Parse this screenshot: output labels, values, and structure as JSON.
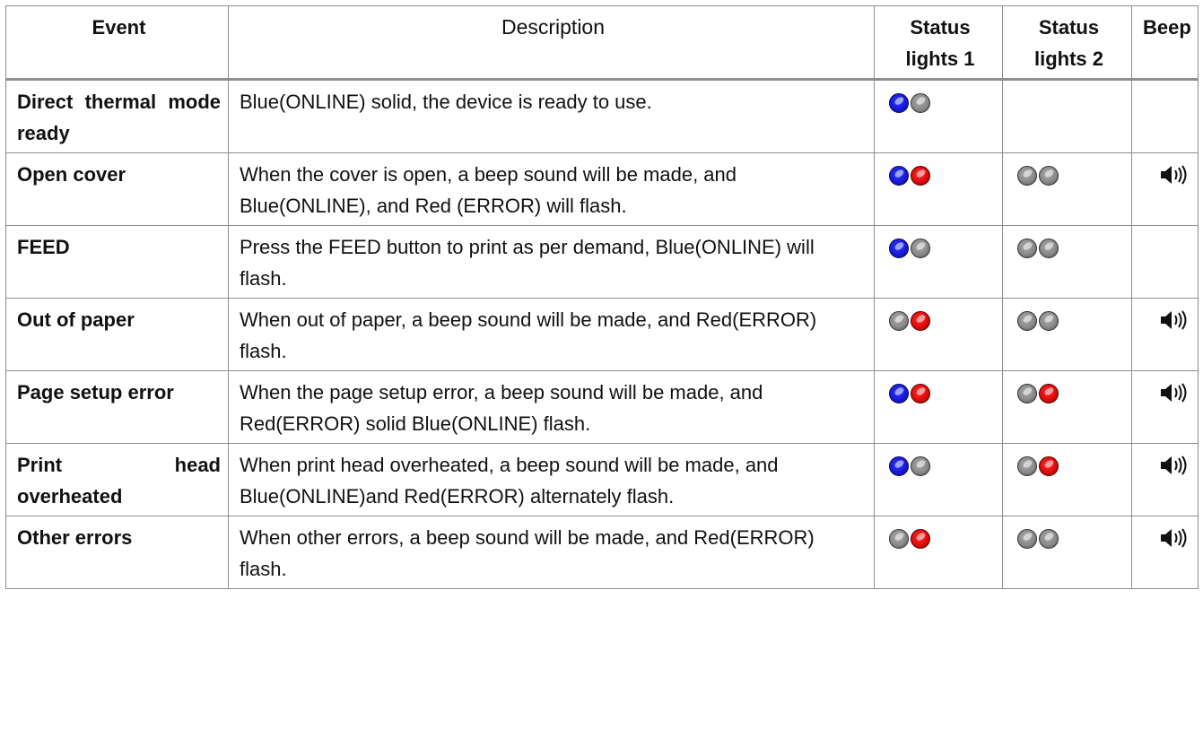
{
  "table": {
    "headers": {
      "event": "Event",
      "description": "Description",
      "status1": "Status lights 1",
      "status2": "Status lights 2",
      "beep": "Beep"
    },
    "rows": [
      {
        "event": "Direct thermal mode ready",
        "description": "Blue(ONLINE) solid, the device is ready to use.",
        "lights1": [
          "blue",
          "gray"
        ],
        "lights2": [],
        "beep": false
      },
      {
        "event": "Open cover",
        "description": "When the cover is open, a beep sound will be made, and Blue(ONLINE), and Red (ERROR) will flash.",
        "lights1": [
          "blue",
          "red"
        ],
        "lights2": [
          "gray",
          "gray"
        ],
        "beep": true
      },
      {
        "event": "FEED",
        "description": "Press the FEED button to print as per demand, Blue(ONLINE) will flash.",
        "lights1": [
          "blue",
          "gray"
        ],
        "lights2": [
          "gray",
          "gray"
        ],
        "beep": false
      },
      {
        "event": "Out of paper",
        "description": "When out of paper, a beep sound will be made, and Red(ERROR) flash.",
        "lights1": [
          "gray",
          "red"
        ],
        "lights2": [
          "gray",
          "gray"
        ],
        "beep": true
      },
      {
        "event": "Page setup error",
        "description": "When the page setup error, a beep sound will be made, and Red(ERROR) solid Blue(ONLINE) flash.",
        "lights1": [
          "blue",
          "red"
        ],
        "lights2": [
          "gray",
          "red"
        ],
        "beep": true
      },
      {
        "event": "Print head overheated",
        "description": "When print head overheated, a beep sound will be made, and Blue(ONLINE)and Red(ERROR) alternately flash.",
        "lights1": [
          "blue",
          "gray"
        ],
        "lights2": [
          "gray",
          "red"
        ],
        "beep": true
      },
      {
        "event": "Other errors",
        "description": "When other errors, a beep sound will be made, and Red(ERROR) flash.",
        "lights1": [
          "gray",
          "red"
        ],
        "lights2": [
          "gray",
          "gray"
        ],
        "beep": true
      }
    ]
  },
  "icons": {
    "led_blue": "blue-led-icon",
    "led_red": "red-led-icon",
    "led_gray": "gray-led-icon",
    "beep": "speaker-icon"
  },
  "colors": {
    "blue": "#1818d8",
    "red": "#e00a0a",
    "gray": "#8a8a8a",
    "border": "#8e8e8e"
  }
}
